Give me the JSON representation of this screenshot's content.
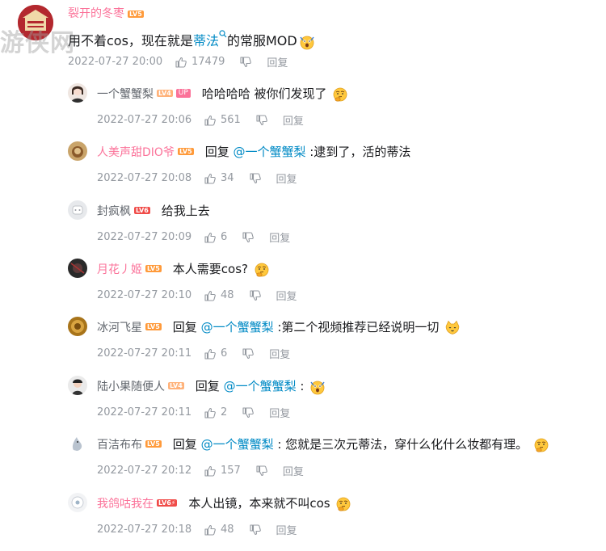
{
  "watermark": "游侠网",
  "top_comment": {
    "username": "裂开的冬枣",
    "level": "LV5",
    "text_before": "用不着cos，现在就是",
    "topic_link": "蒂法",
    "text_after": "的常服MOD",
    "emoji": "surprised-emoji",
    "time": "2022-07-27 20:00",
    "likes": "17479",
    "reply_label": "回复"
  },
  "replies": [
    {
      "username": "一个蟹蟹梨",
      "level": "LV4",
      "up_badge": "UP",
      "name_color": "gray",
      "reply_prefix": "",
      "mention": "",
      "content": "哈哈哈哈 被你们发现了",
      "emoji": "thinking-emoji",
      "time": "2022-07-27 20:06",
      "likes": "561",
      "reply_label": "回复"
    },
    {
      "username": "人美声甜DIO爷",
      "level": "LV5",
      "up_badge": "",
      "name_color": "pink",
      "reply_prefix": "回复",
      "mention": "@一个蟹蟹梨",
      "content": ":逮到了，活的蒂法",
      "emoji": "",
      "time": "2022-07-27 20:08",
      "likes": "34",
      "reply_label": "回复"
    },
    {
      "username": "封疯枫",
      "level": "LV6",
      "up_badge": "",
      "name_color": "gray",
      "reply_prefix": "",
      "mention": "",
      "content": "给我上去",
      "emoji": "",
      "time": "2022-07-27 20:09",
      "likes": "6",
      "reply_label": "回复"
    },
    {
      "username": "月花丿姬",
      "level": "LV5",
      "up_badge": "",
      "name_color": "pink",
      "reply_prefix": "",
      "mention": "",
      "content": "本人需要cos?",
      "emoji": "thinking-emoji",
      "time": "2022-07-27 20:10",
      "likes": "48",
      "reply_label": "回复"
    },
    {
      "username": "冰河飞星",
      "level": "LV5",
      "up_badge": "",
      "name_color": "gray",
      "reply_prefix": "回复",
      "mention": "@一个蟹蟹梨",
      "content": ":第二个视频推荐已经说明一切",
      "emoji": "cat-emoji",
      "time": "2022-07-27 20:11",
      "likes": "6",
      "reply_label": "回复"
    },
    {
      "username": "陆小果随便人",
      "level": "LV4",
      "up_badge": "",
      "name_color": "gray",
      "reply_prefix": "回复",
      "mention": "@一个蟹蟹梨",
      "content": ":",
      "emoji": "surprised-emoji",
      "time": "2022-07-27 20:11",
      "likes": "2",
      "reply_label": "回复"
    },
    {
      "username": "百洁布布",
      "level": "LV5",
      "up_badge": "",
      "name_color": "gray",
      "reply_prefix": "回复",
      "mention": "@一个蟹蟹梨",
      "content": ": 您就是三次元蒂法，穿什么化什么妆都有理。",
      "emoji": "thinking-emoji",
      "time": "2022-07-27 20:12",
      "likes": "157",
      "reply_label": "回复"
    },
    {
      "username": "我鸽咕我在",
      "level": "LV6⚡",
      "up_badge": "",
      "name_color": "pink",
      "reply_prefix": "",
      "mention": "",
      "content": "本人出镜，本来就不叫cos",
      "emoji": "thinking-emoji",
      "time": "2022-07-27 20:18",
      "likes": "48",
      "reply_label": "回复"
    }
  ]
}
